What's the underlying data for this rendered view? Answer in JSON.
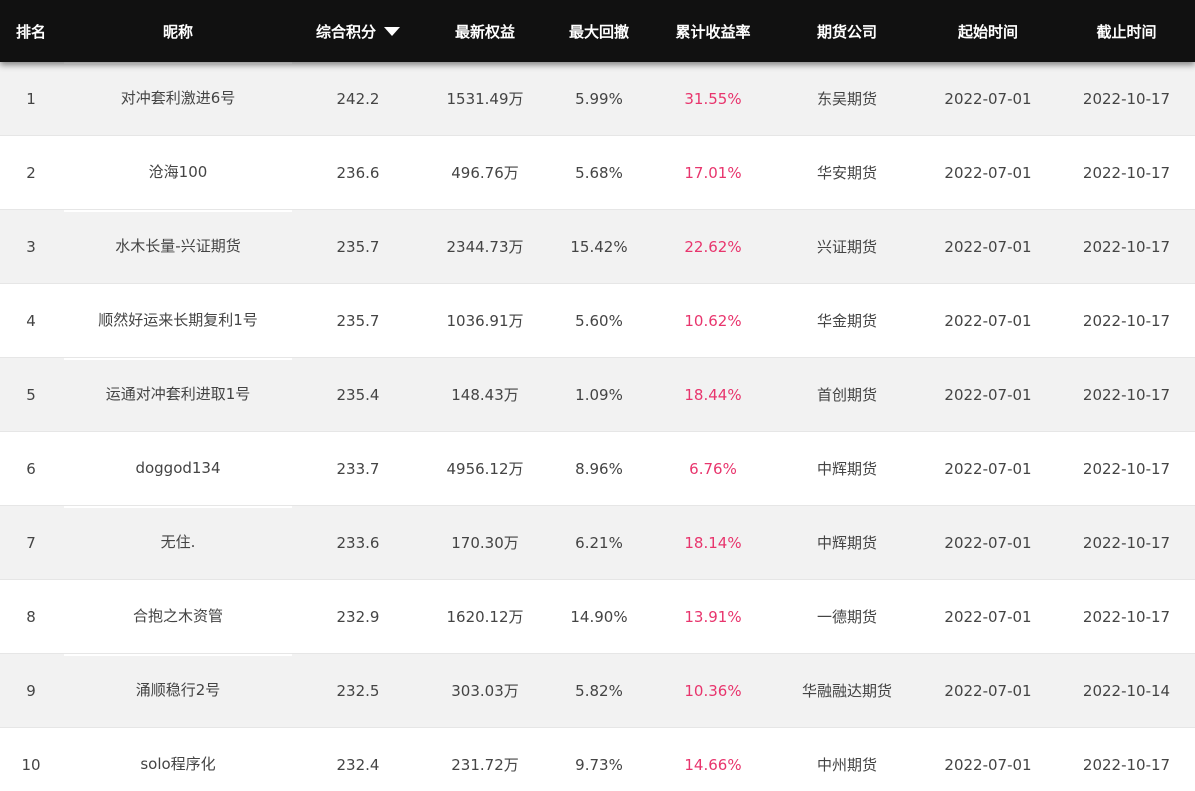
{
  "header": {
    "rank": "排名",
    "name": "昵称",
    "score": "综合积分",
    "equity": "最新权益",
    "drawdown": "最大回撤",
    "return": "累计收益率",
    "broker": "期货公司",
    "start": "起始时间",
    "end": "截止时间"
  },
  "colors": {
    "header_bg": "#111111",
    "header_text": "#ffffff",
    "row_alt_bg": "#f2f2f2",
    "return_text": "#e8356d",
    "body_text": "#444444"
  },
  "rows": [
    {
      "rank": "1",
      "name": "对冲套利激进6号",
      "score": "242.2",
      "equity": "1531.49万",
      "drawdown": "5.99%",
      "return": "31.55%",
      "broker": "东吴期货",
      "start": "2022-07-01",
      "end": "2022-10-17"
    },
    {
      "rank": "2",
      "name": "沧海100",
      "score": "236.6",
      "equity": "496.76万",
      "drawdown": "5.68%",
      "return": "17.01%",
      "broker": "华安期货",
      "start": "2022-07-01",
      "end": "2022-10-17"
    },
    {
      "rank": "3",
      "name": "水木长量-兴证期货",
      "score": "235.7",
      "equity": "2344.73万",
      "drawdown": "15.42%",
      "return": "22.62%",
      "broker": "兴证期货",
      "start": "2022-07-01",
      "end": "2022-10-17"
    },
    {
      "rank": "4",
      "name": "顺然好运来长期复利1号",
      "score": "235.7",
      "equity": "1036.91万",
      "drawdown": "5.60%",
      "return": "10.62%",
      "broker": "华金期货",
      "start": "2022-07-01",
      "end": "2022-10-17"
    },
    {
      "rank": "5",
      "name": "运通对冲套利进取1号",
      "score": "235.4",
      "equity": "148.43万",
      "drawdown": "1.09%",
      "return": "18.44%",
      "broker": "首创期货",
      "start": "2022-07-01",
      "end": "2022-10-17"
    },
    {
      "rank": "6",
      "name": "doggod134",
      "score": "233.7",
      "equity": "4956.12万",
      "drawdown": "8.96%",
      "return": "6.76%",
      "broker": "中辉期货",
      "start": "2022-07-01",
      "end": "2022-10-17"
    },
    {
      "rank": "7",
      "name": "无住.",
      "score": "233.6",
      "equity": "170.30万",
      "drawdown": "6.21%",
      "return": "18.14%",
      "broker": "中辉期货",
      "start": "2022-07-01",
      "end": "2022-10-17"
    },
    {
      "rank": "8",
      "name": "合抱之木资管",
      "score": "232.9",
      "equity": "1620.12万",
      "drawdown": "14.90%",
      "return": "13.91%",
      "broker": "一德期货",
      "start": "2022-07-01",
      "end": "2022-10-17"
    },
    {
      "rank": "9",
      "name": "涌顺稳行2号",
      "score": "232.5",
      "equity": "303.03万",
      "drawdown": "5.82%",
      "return": "10.36%",
      "broker": "华融融达期货",
      "start": "2022-07-01",
      "end": "2022-10-14"
    },
    {
      "rank": "10",
      "name": "solo程序化",
      "score": "232.4",
      "equity": "231.72万",
      "drawdown": "9.73%",
      "return": "14.66%",
      "broker": "中州期货",
      "start": "2022-07-01",
      "end": "2022-10-17"
    }
  ]
}
